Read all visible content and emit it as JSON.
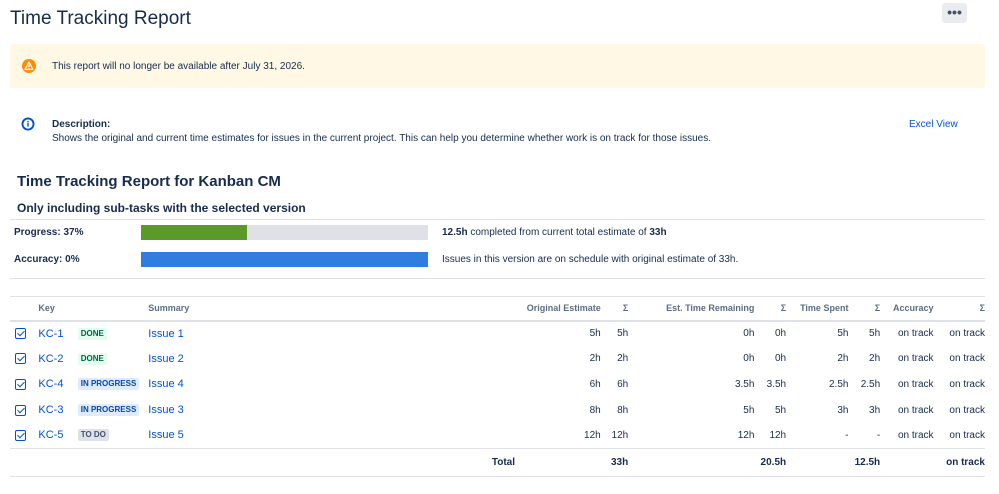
{
  "header": {
    "title": "Time Tracking Report",
    "more_label": "•••"
  },
  "warning": {
    "icon": "warning-icon",
    "text": "This report will no longer be available after July 31, 2026."
  },
  "description": {
    "icon": "info-icon",
    "label": "Description:",
    "text": "Shows the original and current time estimates for issues in the current project. This can help you determine whether work is on track for those issues.",
    "excel_link": "Excel View"
  },
  "report": {
    "title": "Time Tracking Report for Kanban CM",
    "subtitle": "Only including sub-tasks with the selected version"
  },
  "progress": {
    "label": "Progress: 37%",
    "percent": 37,
    "color": "#5b9a2a",
    "desc_strong": "12.5h",
    "desc_mid": " completed from current total estimate of ",
    "desc_strong2": "33h"
  },
  "accuracy": {
    "label": "Accuracy: 0%",
    "percent": 100,
    "color": "#2f7de1",
    "desc": "Issues in this version are on schedule with original estimate of 33h."
  },
  "table": {
    "columns": {
      "key": "Key",
      "summary": "Summary",
      "original": "Original Estimate",
      "sigma": "Σ",
      "remaining": "Est. Time Remaining",
      "spent": "Time Spent",
      "accuracy": "Accuracy"
    },
    "rows": [
      {
        "key": "KC-1",
        "status": "DONE",
        "status_bg": "#e3fcef",
        "status_fg": "#006644",
        "summary": "Issue 1",
        "orig": "5h",
        "orig_sum": "5h",
        "rem": "0h",
        "rem_sum": "0h",
        "spent": "5h",
        "spent_sum": "5h",
        "acc": "on track",
        "acc_sum": "on track"
      },
      {
        "key": "KC-2",
        "status": "DONE",
        "status_bg": "#e3fcef",
        "status_fg": "#006644",
        "summary": "Issue 2",
        "orig": "2h",
        "orig_sum": "2h",
        "rem": "0h",
        "rem_sum": "0h",
        "spent": "2h",
        "spent_sum": "2h",
        "acc": "on track",
        "acc_sum": "on track"
      },
      {
        "key": "KC-4",
        "status": "IN PROGRESS",
        "status_bg": "#deebff",
        "status_fg": "#0747a6",
        "summary": "Issue 4",
        "orig": "6h",
        "orig_sum": "6h",
        "rem": "3.5h",
        "rem_sum": "3.5h",
        "spent": "2.5h",
        "spent_sum": "2.5h",
        "acc": "on track",
        "acc_sum": "on track"
      },
      {
        "key": "KC-3",
        "status": "IN PROGRESS",
        "status_bg": "#deebff",
        "status_fg": "#0747a6",
        "summary": "Issue 3",
        "orig": "8h",
        "orig_sum": "8h",
        "rem": "5h",
        "rem_sum": "5h",
        "spent": "3h",
        "spent_sum": "3h",
        "acc": "on track",
        "acc_sum": "on track"
      },
      {
        "key": "KC-5",
        "status": "TO DO",
        "status_bg": "#dfe1e6",
        "status_fg": "#42526e",
        "summary": "Issue 5",
        "orig": "12h",
        "orig_sum": "12h",
        "rem": "12h",
        "rem_sum": "12h",
        "spent": "-",
        "spent_sum": "-",
        "acc": "on track",
        "acc_sum": "on track"
      }
    ],
    "total": {
      "label": "Total",
      "orig": "33h",
      "rem": "20.5h",
      "spent": "12.5h",
      "acc": "on track"
    }
  }
}
